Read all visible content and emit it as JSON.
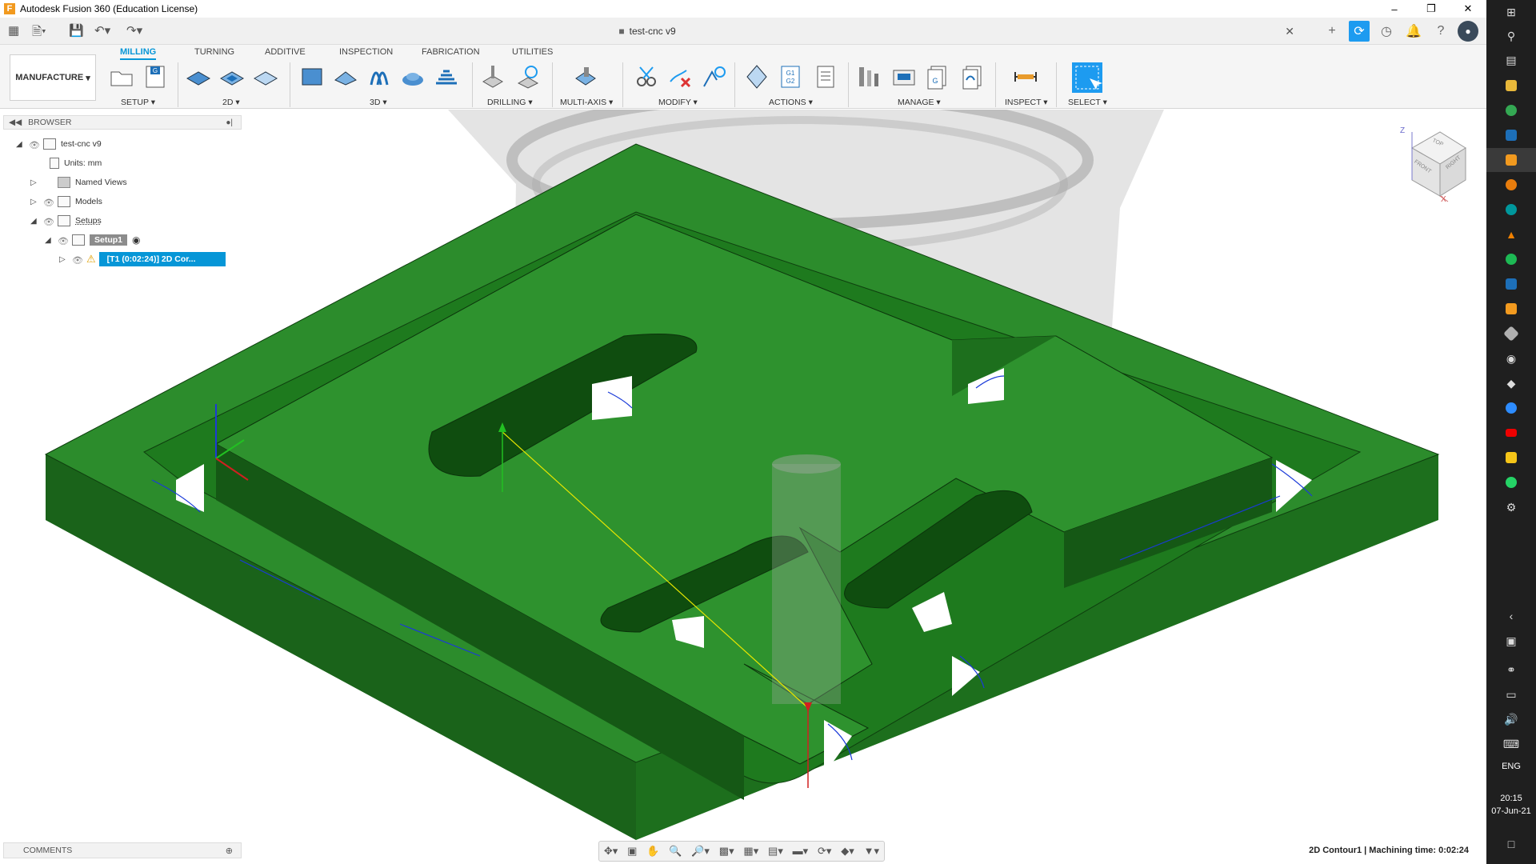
{
  "window": {
    "title": "Autodesk Fusion 360 (Education License)",
    "document_tab": "test-cnc v9"
  },
  "ribbon": {
    "workspace": "MANUFACTURE",
    "tabs": [
      "MILLING",
      "TURNING",
      "ADDITIVE",
      "INSPECTION",
      "FABRICATION",
      "UTILITIES"
    ],
    "active_tab": "MILLING",
    "groups": [
      "SETUP ▾",
      "2D ▾",
      "3D ▾",
      "DRILLING ▾",
      "MULTI-AXIS ▾",
      "MODIFY ▾",
      "ACTIONS ▾",
      "MANAGE ▾",
      "INSPECT ▾",
      "SELECT ▾"
    ]
  },
  "browser": {
    "title": "BROWSER",
    "root": "test-cnc v9",
    "units": "Units: mm",
    "named_views": "Named Views",
    "models": "Models",
    "setups": "Setups",
    "setup1": "Setup1",
    "operation": "[T1 (0:02:24)] 2D Cor..."
  },
  "comments": {
    "title": "COMMENTS"
  },
  "viewcube": {
    "top": "TOP",
    "front": "FRONT",
    "right": "RIGHT",
    "axis_z": "Z",
    "axis_x": "X"
  },
  "status": {
    "text": "2D Contour1 | Machining time: 0:02:24"
  },
  "taskbar": {
    "language": "ENG",
    "time": "20:15",
    "date": "07-Jun-21"
  },
  "colors": {
    "part_top": "#2c8c2c",
    "part_side": "#1d6f1d",
    "accent": "#0696d7",
    "toolpath": "#1a3ad8"
  }
}
